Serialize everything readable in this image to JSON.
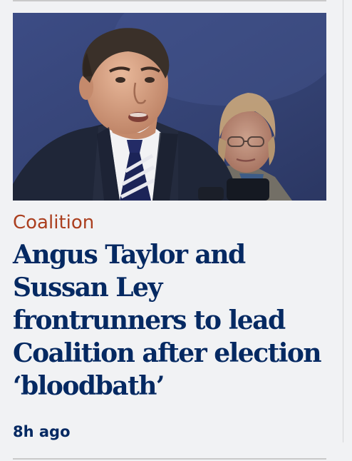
{
  "article": {
    "kicker": "Coalition",
    "headline": "Angus Taylor and Sussan Ley frontrunners to lead Coalition after election ‘bloodbath’",
    "age": "8h ago",
    "image": "Angus Taylor and Sussan Ley at a press conference"
  },
  "colors": {
    "background": "#f1f2f4",
    "kicker": "#ab3f1f",
    "headline": "#052962",
    "rule": "#c9c9c9"
  }
}
